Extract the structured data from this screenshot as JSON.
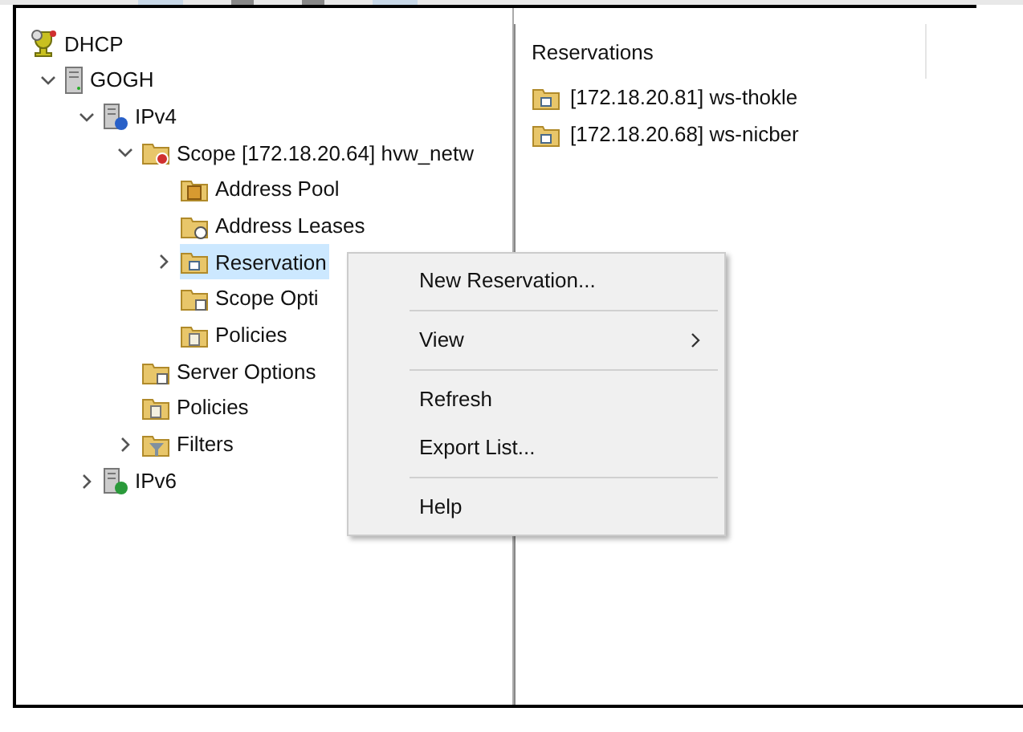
{
  "tree": [
    {
      "label": "DHCP",
      "kind": "root",
      "selected": false,
      "children": [
        {
          "label": "GOGH",
          "kind": "server",
          "expanded": true,
          "selected": false,
          "children": [
            {
              "label": "IPv4",
              "kind": "ipv4",
              "expanded": true,
              "selected": false,
              "children": [
                {
                  "label": "Scope [172.18.20.64] hvw_netw",
                  "kind": "scope",
                  "expanded": true,
                  "selected": false,
                  "children": [
                    {
                      "label": "Address Pool",
                      "kind": "pool",
                      "selected": false
                    },
                    {
                      "label": "Address Leases",
                      "kind": "leases",
                      "selected": false
                    },
                    {
                      "label": "Reservation",
                      "kind": "reservations",
                      "expanded": false,
                      "selected": true
                    },
                    {
                      "label": "Scope Opti",
                      "kind": "options",
                      "selected": false
                    },
                    {
                      "label": "Policies",
                      "kind": "policies",
                      "selected": false
                    }
                  ]
                },
                {
                  "label": "Server Options",
                  "kind": "options",
                  "selected": false
                },
                {
                  "label": "Policies",
                  "kind": "policies",
                  "selected": false
                },
                {
                  "label": "Filters",
                  "kind": "filters",
                  "expanded": false,
                  "selected": false
                }
              ]
            },
            {
              "label": "IPv6",
              "kind": "ipv6",
              "expanded": false,
              "selected": false
            }
          ]
        }
      ]
    }
  ],
  "list": {
    "column_1": "Reservations",
    "rows": [
      {
        "label": "[172.18.20.81] ws-thokle"
      },
      {
        "label": "[172.18.20.68] ws-nicber"
      }
    ]
  },
  "context_menu": [
    [
      {
        "label": "New Reservation..."
      }
    ],
    [
      {
        "label": "View",
        "submenu": true
      }
    ],
    [
      {
        "label": "Refresh"
      },
      {
        "label": "Export List..."
      }
    ],
    [
      {
        "label": "Help"
      }
    ]
  ]
}
